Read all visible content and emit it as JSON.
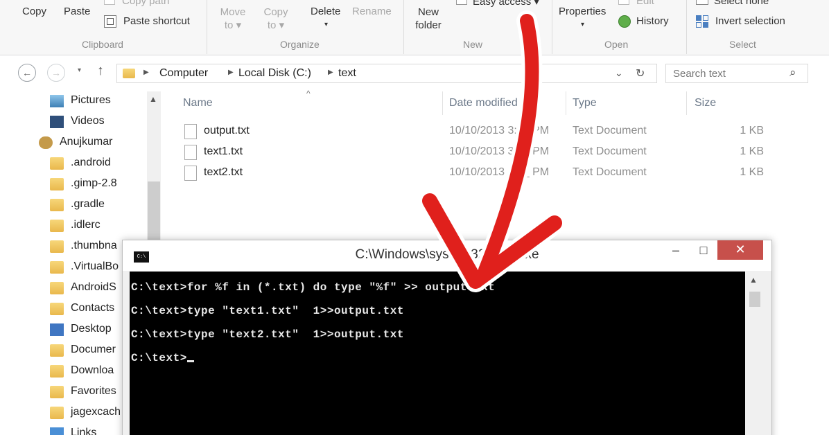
{
  "ribbon": {
    "clipboard": {
      "copy": "Copy",
      "paste": "Paste",
      "copy_path": "Copy path",
      "paste_shortcut": "Paste shortcut",
      "label": "Clipboard"
    },
    "organize": {
      "move_to": "Move\nto ▾",
      "copy_to": "Copy\nto ▾",
      "delete": "Delete",
      "rename": "Rename",
      "label": "Organize"
    },
    "new": {
      "new_folder": "New\nfolder",
      "easy_access": "Easy access ▾",
      "label": "New"
    },
    "open": {
      "properties": "Properties",
      "edit": "Edit",
      "history": "History",
      "label": "Open"
    },
    "select": {
      "select_none": "Select none",
      "invert_selection": "Invert selection",
      "label": "Select"
    }
  },
  "address": {
    "crumbs": [
      "Computer",
      "Local Disk (C:)",
      "text"
    ],
    "search_placeholder": "Search text"
  },
  "nav_pane": {
    "items": [
      "Pictures",
      "Videos",
      "Anujkumar",
      ".android",
      ".gimp-2.8",
      ".gradle",
      ".idlerc",
      ".thumbna",
      ".VirtualBo",
      "AndroidS",
      "Contacts",
      "Desktop",
      "Documer",
      "Downloa",
      "Favorites",
      "jagexcach",
      "Links"
    ]
  },
  "file_list": {
    "columns": [
      "Name",
      "Date modified",
      "Type",
      "Size"
    ],
    "rows": [
      {
        "name": "output.txt",
        "date": "10/10/2013 3:__ PM",
        "type": "Text Document",
        "size": "1 KB"
      },
      {
        "name": "text1.txt",
        "date": "10/10/2013 3:__ PM",
        "type": "Text Document",
        "size": "1 KB"
      },
      {
        "name": "text2.txt",
        "date": "10/10/2013 3:__ PM",
        "type": "Text Document",
        "size": "1 KB"
      }
    ]
  },
  "cmd": {
    "title": "C:\\Windows\\system32\\cmd.exe",
    "minimize": "–",
    "maximize": "□",
    "close": "✕",
    "lines": [
      "C:\\text>for %f in (*.txt) do type \"%f\" >> output.txt",
      "C:\\text>type \"text1.txt\"  1>>output.txt",
      "C:\\text>type \"text2.txt\"  1>>output.txt",
      "C:\\text>"
    ]
  },
  "colors": {
    "arrow": "#e0201c",
    "close_button": "#c7504b",
    "console_bg": "#000000",
    "console_text": "#e8e8e8",
    "folder": "#f0c55e"
  }
}
